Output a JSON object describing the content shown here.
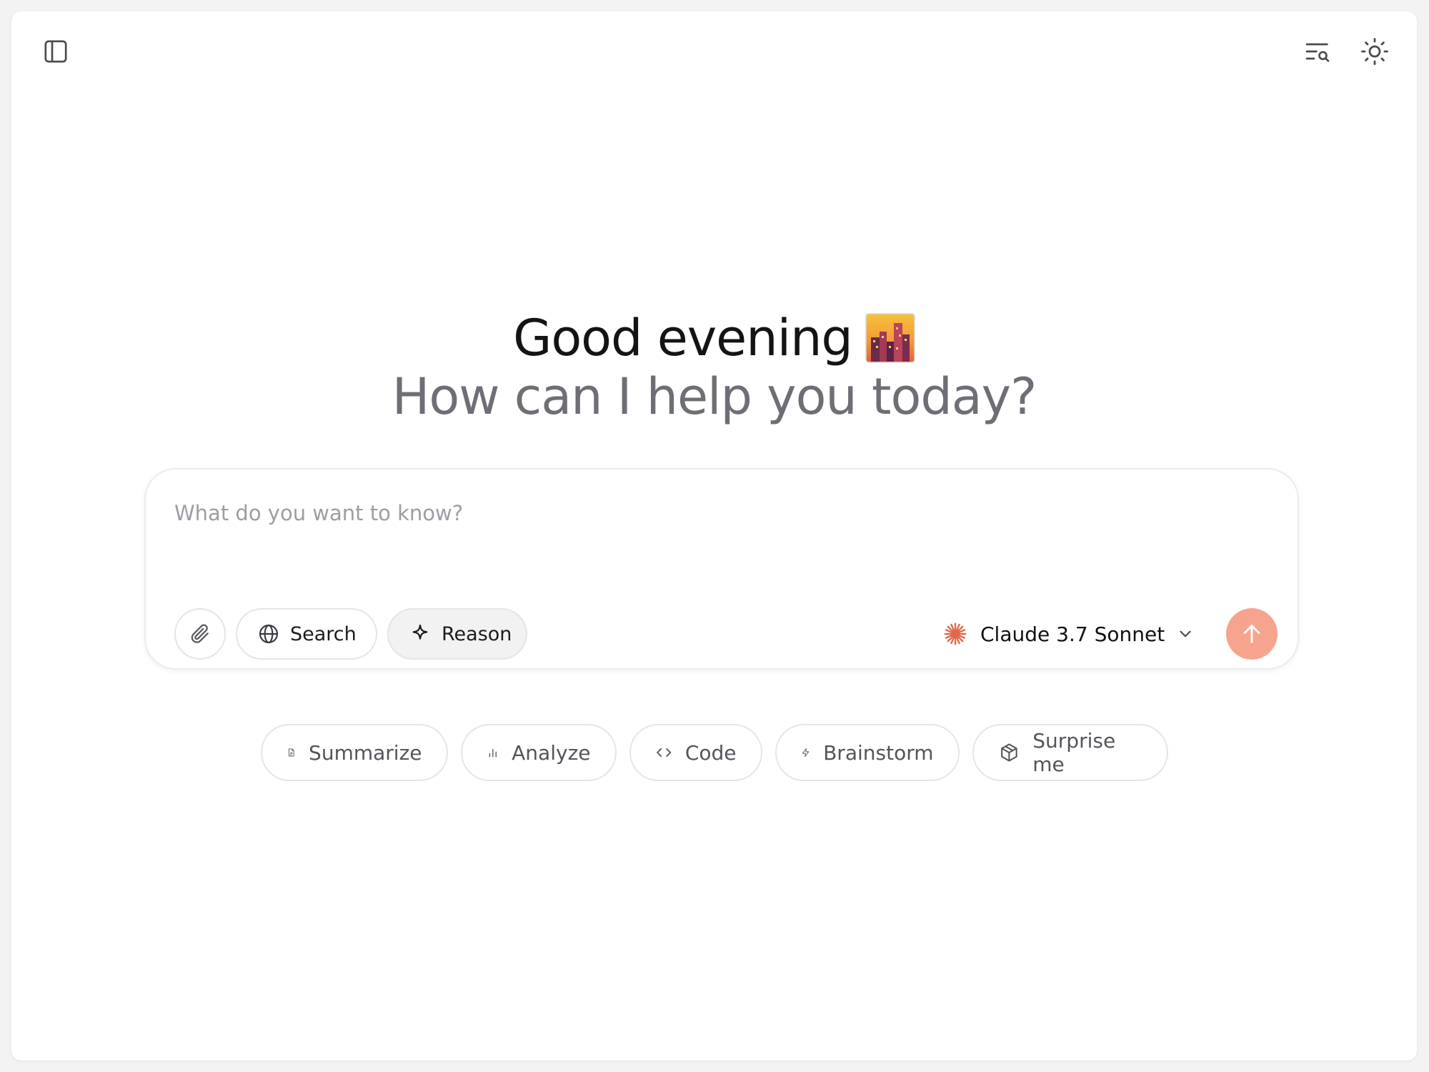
{
  "colors": {
    "accent": "#f7a48f",
    "accent_icon": "#e1674a",
    "text_primary": "#141414",
    "text_secondary": "#6e6e76"
  },
  "header": {
    "left_icon": "sidebar-icon",
    "right_icons": [
      "search-history-icon",
      "sun-icon"
    ]
  },
  "hero": {
    "greeting": "Good evening",
    "greeting_icon": "city-dusk-icon",
    "subtitle": "How can I help you today?"
  },
  "composer": {
    "placeholder": "What do you want to know?",
    "value": "",
    "tools": [
      {
        "id": "attach",
        "icon": "paperclip-icon",
        "label": ""
      },
      {
        "id": "search",
        "icon": "globe-icon",
        "label": "Search"
      },
      {
        "id": "reason",
        "icon": "sparkle-icon",
        "label": "Reason"
      }
    ],
    "model": {
      "icon": "claude-logo-icon",
      "label": "Claude 3.7 Sonnet",
      "chevron": "chevron-down-icon"
    },
    "send_icon": "arrow-up-icon"
  },
  "suggestions": [
    {
      "icon": "document-icon",
      "label": "Summarize"
    },
    {
      "icon": "bar-chart-icon",
      "label": "Analyze"
    },
    {
      "icon": "code-icon",
      "label": "Code"
    },
    {
      "icon": "lightning-icon",
      "label": "Brainstorm"
    },
    {
      "icon": "cube-icon",
      "label": "Surprise me"
    }
  ]
}
